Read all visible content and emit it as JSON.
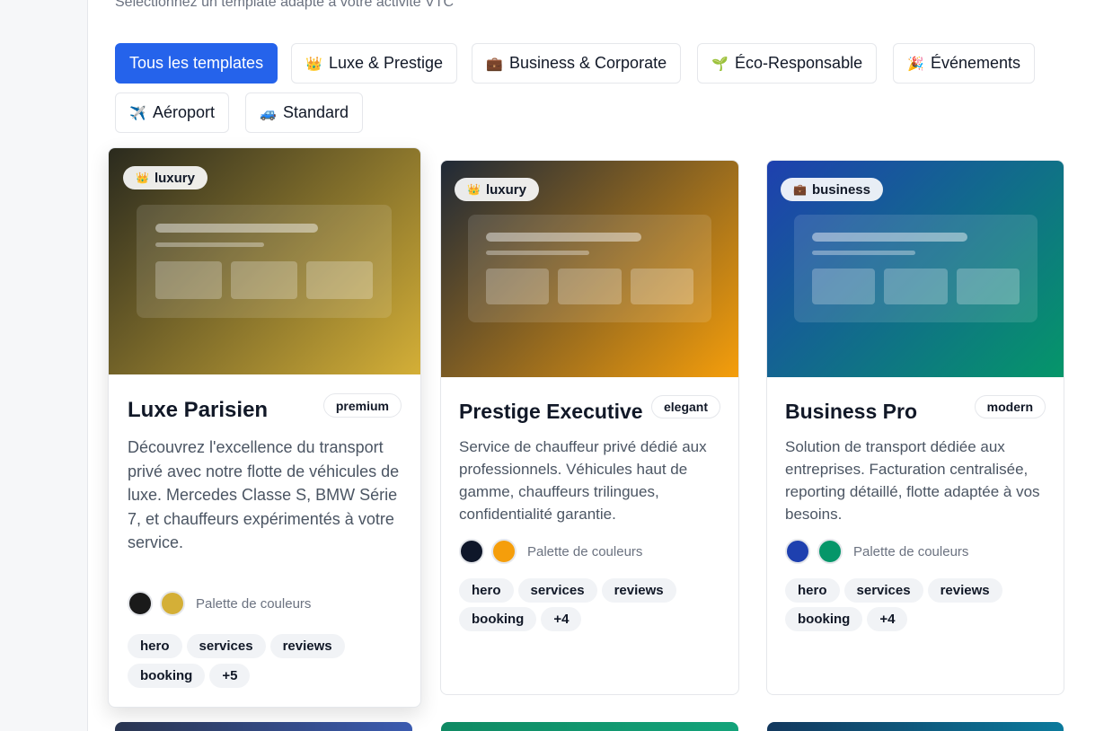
{
  "header": {
    "subtitle": "Sélectionnez un template adapté à votre activité VTC"
  },
  "filters": [
    {
      "label": "Tous les templates",
      "icon": "",
      "active": true
    },
    {
      "label": "Luxe & Prestige",
      "icon": "👑"
    },
    {
      "label": "Business & Corporate",
      "icon": "💼"
    },
    {
      "label": "Éco-Responsable",
      "icon": "🌱"
    },
    {
      "label": "Événements",
      "icon": "🎉"
    },
    {
      "label": "Aéroport",
      "icon": "✈️"
    },
    {
      "label": "Standard",
      "icon": "🚙"
    }
  ],
  "cards": [
    {
      "badge": {
        "icon": "👑",
        "label": "luxury"
      },
      "title": "Luxe Parisien",
      "style": "premium",
      "description": "Découvrez l'excellence du transport privé avec notre flotte de véhicules de luxe. Mercedes Classe S, BMW Série 7, et chauffeurs expérimentés à votre service.",
      "palette": [
        "#1a1a1a",
        "#d4af37"
      ],
      "palette_label": "Palette de couleurs",
      "tags": [
        "hero",
        "services",
        "reviews",
        "booking",
        "+5"
      ],
      "gradient": [
        "#2a2a1e",
        "#d4af37"
      ]
    },
    {
      "badge": {
        "icon": "👑",
        "label": "luxury"
      },
      "title": "Prestige Executive",
      "style": "elegant",
      "description": "Service de chauffeur privé dédié aux professionnels. Véhicules haut de gamme, chauffeurs trilingues, confidentialité garantie.",
      "palette": [
        "#0f172a",
        "#f59e0b"
      ],
      "palette_label": "Palette de couleurs",
      "tags": [
        "hero",
        "services",
        "reviews",
        "booking",
        "+4"
      ],
      "gradient": [
        "#1f2937",
        "#f59e0b"
      ]
    },
    {
      "badge": {
        "icon": "💼",
        "label": "business"
      },
      "title": "Business Pro",
      "style": "modern",
      "description": "Solution de transport dédiée aux entreprises. Facturation centralisée, reporting détaillé, flotte adaptée à vos besoins.",
      "palette": [
        "#1e40af",
        "#059669"
      ],
      "palette_label": "Palette de couleurs",
      "tags": [
        "hero",
        "services",
        "reviews",
        "booking",
        "+4"
      ],
      "gradient": [
        "#1e40af",
        "#059669"
      ]
    }
  ],
  "peek_colors": [
    [
      "#2a3550",
      "#3b5bb0"
    ],
    [
      "#0f8a63",
      "#13a37a"
    ],
    [
      "#12385e",
      "#0b7a9c"
    ]
  ]
}
